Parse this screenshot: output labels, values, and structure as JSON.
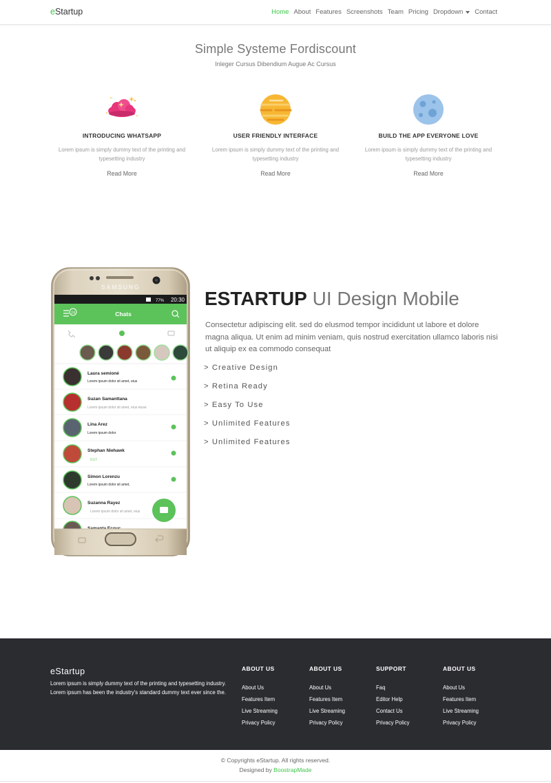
{
  "nav": {
    "brand_e": "e",
    "brand_rest": "Startup",
    "items": [
      "Home",
      "About",
      "Features",
      "Screenshots",
      "Team",
      "Pricing",
      "Dropdown",
      "Contact"
    ]
  },
  "hero": {
    "title": "Simple Systeme Fordiscount",
    "subtitle": "Inleger Cursus Dibendium Augue Ac Cursus"
  },
  "features": [
    {
      "icon": "cloud-icon",
      "title": "INTRODUCING WHATSAPP",
      "desc": "Lorem ipsum is simply dummy text of the printing and typesetting industry",
      "more": "Read More"
    },
    {
      "icon": "planet-icon",
      "title": "USER FRIENDLY INTERFACE",
      "desc": "Lorem ipsum is simply dummy text of the printing and typesetting industry",
      "more": "Read More"
    },
    {
      "icon": "moon-icon",
      "title": "BUILD THE APP EVERYONE LOVE",
      "desc": "Lorem ipsum is simply dummy text of the printing and typesetting industry",
      "more": "Read More"
    }
  ],
  "about": {
    "title_bold": "ESTARTUP",
    "title_light": "UI Design Mobile",
    "desc": "Consectetur adipiscing elit. sed do elusmod tempor incididunt ut labore et dolore magna aliqua. Ut enim ad minim veniam, quis nostrud exercitation ullamco laboris nisi ut aliquip ex ea commodo consequat",
    "list": [
      "> Creative Design",
      "> Retina Ready",
      "> Easy To Use",
      "> Unlimited Features",
      "> Unlimited Features"
    ]
  },
  "phone": {
    "brand": "SAMSUNG",
    "status_time": "20:30",
    "status_battery": "77%",
    "header_title": "Chats",
    "unread_badge": "24",
    "contacts": [
      {
        "name": "Laura semioné",
        "msg": "Lorem ipsum dolor sit amet, eius"
      },
      {
        "name": "Suzan Samanttana",
        "msg": "Lorem ipsum dolor sit amet, eius eiuse"
      },
      {
        "name": "Lina Arez",
        "msg": "Lorem ipsum dolor"
      },
      {
        "name": "Stephan Niehawk",
        "msg": "0:17"
      },
      {
        "name": "Simon Lorenzu",
        "msg": "Lorem ipsum dolor sit amet,"
      },
      {
        "name": "Suzanna Rayez",
        "msg": "Lorem ipsum dolor sit amet, eius"
      },
      {
        "name": "Samanta Ecouc",
        "msg": ""
      }
    ]
  },
  "footer": {
    "brand": "eStartup",
    "desc": "Lorem ipsum is simply dummy text of the printing and typesetting industry. Lorem ipsum has been the industry's standard dummy text ever since the.",
    "columns": [
      {
        "title": "ABOUT US",
        "links": [
          "About Us",
          "Features Item",
          "Live Streaming",
          "Privacy Policy"
        ]
      },
      {
        "title": "ABOUT US",
        "links": [
          "About Us",
          "Features Item",
          "Live Streaming",
          "Privacy Policy"
        ]
      },
      {
        "title": "SUPPORT",
        "links": [
          "Faq",
          "Editor Help",
          "Contact Us",
          "Privacy Policy"
        ]
      },
      {
        "title": "ABOUT US",
        "links": [
          "About Us",
          "Features Item",
          "Live Streaming",
          "Privacy Policy"
        ]
      }
    ]
  },
  "bottom": {
    "copyright": "© Copyrights eStartup. All rights reserved.",
    "designed_prefix": "Designed by",
    "designed_link": "BoostrapMade"
  },
  "colors": {
    "accent": "#3ec74a",
    "footer_bg": "#2b2c30"
  }
}
